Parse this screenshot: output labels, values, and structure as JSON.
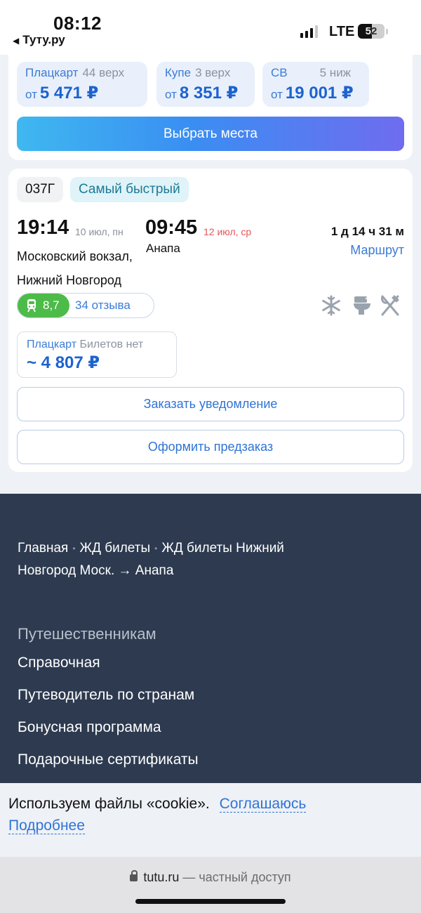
{
  "status_bar": {
    "time": "08:12",
    "back_label": "Туту.ру",
    "network": "LTE",
    "battery": "52",
    "battery_level": 0.52
  },
  "fares": [
    {
      "class": "Плацкарт",
      "seats": "44 верх",
      "from": "от",
      "price": "5 471 ₽"
    },
    {
      "class": "Купе",
      "seats": "3 верх",
      "from": "от",
      "price": "8 351 ₽"
    },
    {
      "class": "СВ",
      "seats": "5 ниж",
      "from": "от",
      "price": "19 001 ₽"
    }
  ],
  "choose_seats_label": "Выбрать места",
  "train": {
    "number": "037Г",
    "badge": "Самый быстрый",
    "departure_time": "19:14",
    "departure_date": "10 июл, пн",
    "arrival_time": "09:45",
    "arrival_date": "12 июл, ср",
    "duration": "1 д 14 ч 31 м",
    "from_station_line1": "Московский вокзал,",
    "from_station_line2": "Нижний Новгород",
    "to_station": "Анапа",
    "route_link": "Маршрут",
    "rating": "8,7",
    "reviews": "34 отзыва",
    "amenities": [
      "snowflake-icon",
      "toilet-icon",
      "dining-icon"
    ],
    "offer_class": "Плацкарт",
    "offer_status": "Билетов нет",
    "offer_price": "~ 4 807 ₽",
    "notify_label": "Заказать уведомление",
    "preorder_label": "Оформить предзаказ"
  },
  "footer": {
    "breadcrumbs": [
      "Главная",
      "ЖД билеты",
      "ЖД билеты Нижний Новгород Моск. → Анапа"
    ],
    "section_title": "Путешественникам",
    "links": [
      "Справочная",
      "Путеводитель по странам",
      "Бонусная программа",
      "Подарочные сертификаты"
    ]
  },
  "cookie": {
    "text": "Используем файлы «cookie».",
    "agree": "Соглашаюсь",
    "more": "Подробнее"
  },
  "browser": {
    "domain": "tutu.ru",
    "mode": "— частный доступ"
  },
  "colors": {
    "accent": "#2f74d6",
    "price": "#1d63cf",
    "rating": "#4dbb49",
    "arrival_date": "#e0565b",
    "footer_bg": "#2d3a4f"
  }
}
